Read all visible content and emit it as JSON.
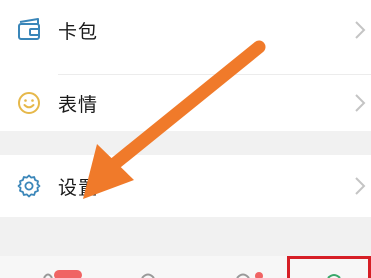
{
  "menu": {
    "items": [
      {
        "label": "卡包",
        "icon": "card-wallet-icon"
      },
      {
        "label": "表情",
        "icon": "emoji-smile-icon"
      },
      {
        "label": "设置",
        "icon": "settings-gear-icon"
      }
    ]
  },
  "colors": {
    "accent": "#f07a2a",
    "highlight_box": "#d61f26",
    "icon_blue": "#3a86b9",
    "icon_yellow": "#e6b84a"
  }
}
